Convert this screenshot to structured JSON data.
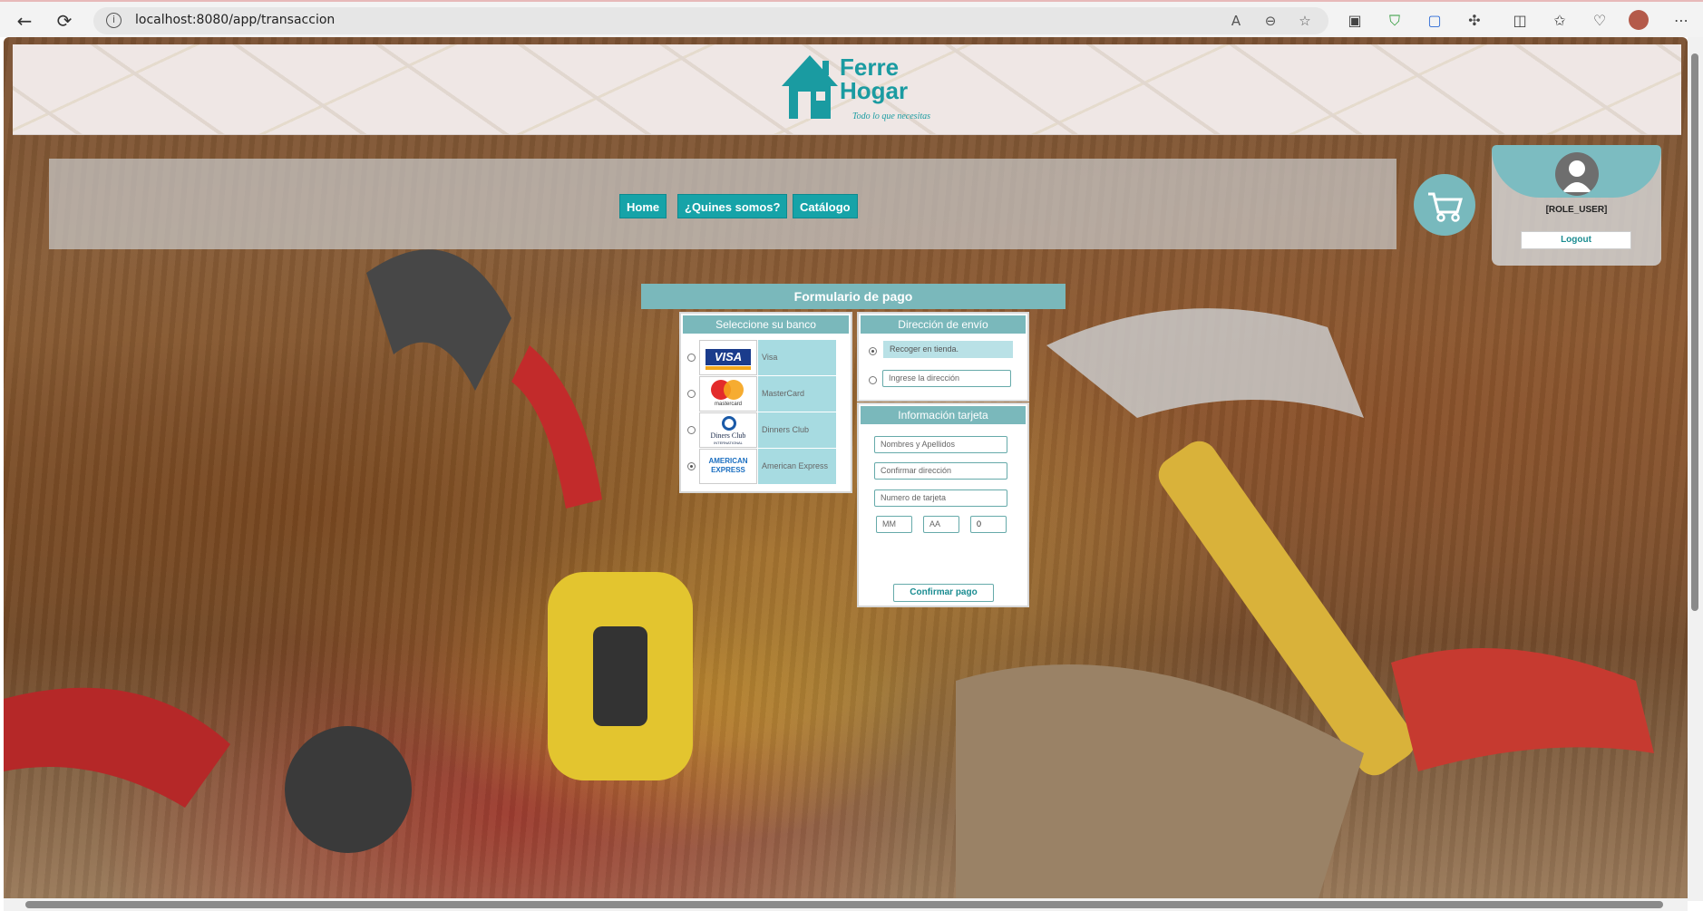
{
  "browser": {
    "url": "localhost:8080/app/transaccion",
    "back_icon": "back-arrow-icon",
    "reload_icon": "reload-icon",
    "info_icon": "info-icon"
  },
  "header": {
    "logo_title": "Ferre Hogar",
    "logo_title_line1": "Ferre",
    "logo_title_line2": "Hogar",
    "logo_tagline": "Todo lo que necesitas"
  },
  "nav": {
    "items": [
      {
        "label": "Home"
      },
      {
        "label": "¿Quines somos?"
      },
      {
        "label": "Catálogo"
      }
    ]
  },
  "user": {
    "role": "[ROLE_USER]",
    "logout_label": "Logout"
  },
  "payment": {
    "title": "Formulario de pago",
    "bank_section": {
      "heading": "Seleccione su banco",
      "options": [
        {
          "name": "Visa",
          "selected": false,
          "logo_text": "VISA"
        },
        {
          "name": "MasterCard",
          "selected": false,
          "logo_text": "mastercard"
        },
        {
          "name": "Dinners Club",
          "selected": false,
          "logo_text": "Diners Club"
        },
        {
          "name": "American Express",
          "selected": true,
          "logo_text": "AMERICAN EXPRESS"
        }
      ],
      "diners_logo_sub": "INTERNATIONAL"
    },
    "shipping_section": {
      "heading": "Dirección de envío",
      "pickup_label": "Recoger en tienda.",
      "address_placeholder": "Ingrese la dirección"
    },
    "card_section": {
      "heading": "Información tarjeta",
      "name_placeholder": "Nombres y Apellidos",
      "confirm_address_placeholder": "Confirmar dirección",
      "card_number_placeholder": "Numero de tarjeta",
      "month_placeholder": "MM",
      "year_placeholder": "AA",
      "cvv_value": "0",
      "confirm_label": "Confirmar pago"
    }
  },
  "colors": {
    "teal": "#16a3a8",
    "panel_teal": "#7ab8bb",
    "light_blue": "#a7dbe1"
  }
}
